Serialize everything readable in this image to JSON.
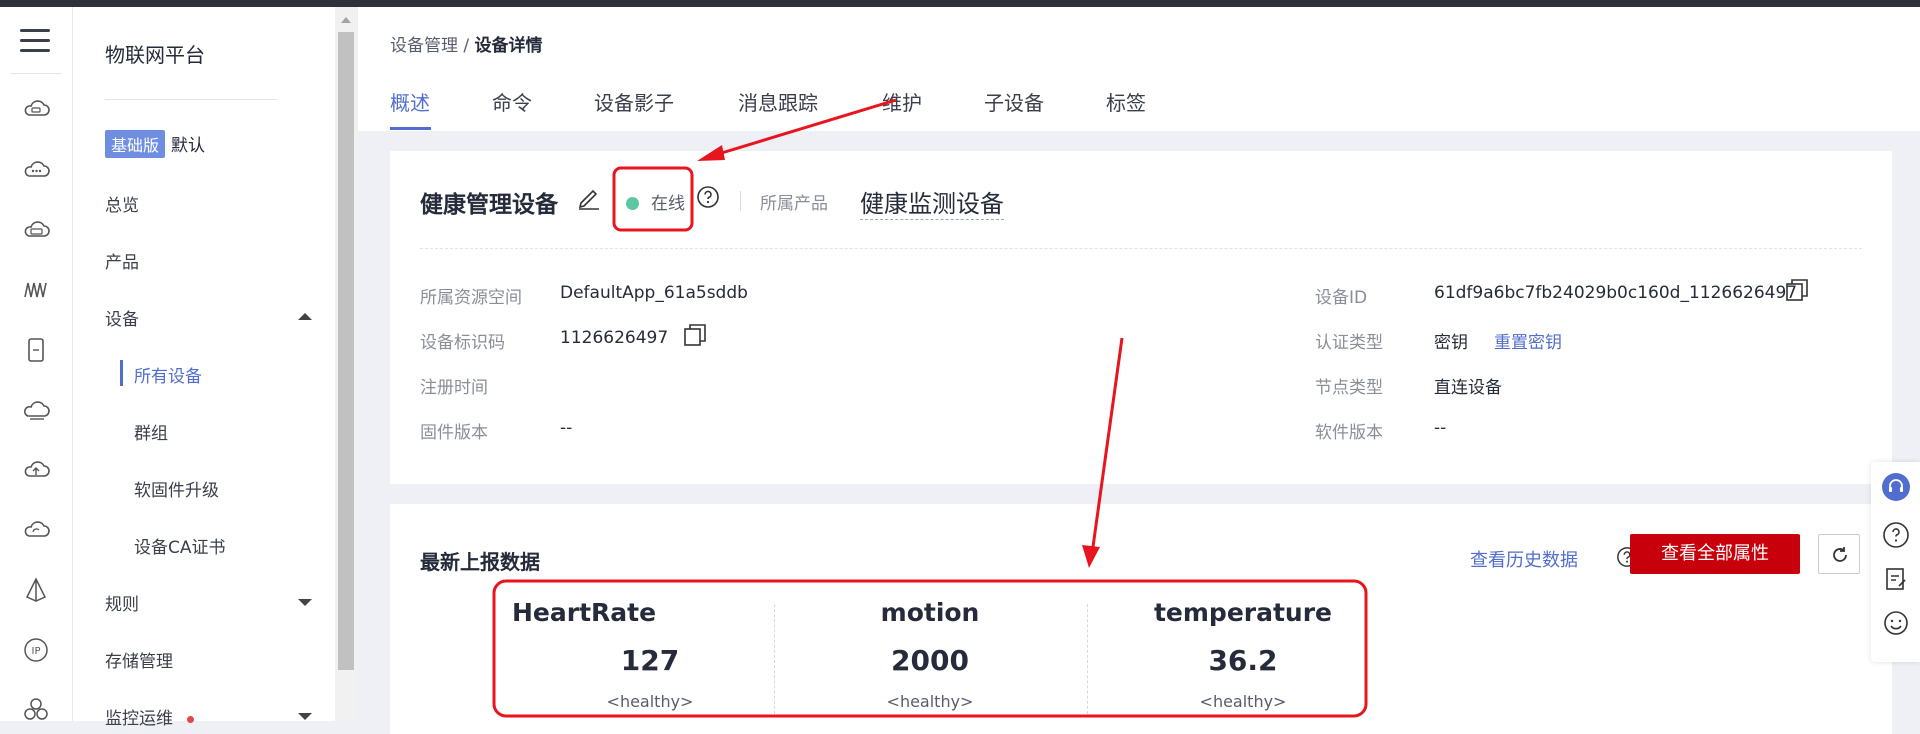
{
  "nav": {
    "title": "物联网平台",
    "edition_badge": "基础版",
    "edition_name": "默认",
    "items": [
      {
        "label": "总览"
      },
      {
        "label": "产品"
      },
      {
        "label": "设备"
      },
      {
        "label": "所有设备"
      },
      {
        "label": "群组"
      },
      {
        "label": "软固件升级"
      },
      {
        "label": "设备CA证书"
      },
      {
        "label": "规则"
      },
      {
        "label": "存储管理"
      },
      {
        "label": "监控运维"
      }
    ]
  },
  "breadcrumb": {
    "parent": "设备管理 / ",
    "current": "设备详情"
  },
  "tabs": [
    "概述",
    "命令",
    "设备影子",
    "消息跟踪",
    "维护",
    "子设备",
    "标签"
  ],
  "device": {
    "name": "健康管理设备",
    "status": "在线",
    "product_label": "所属产品",
    "product_name": "健康监测设备"
  },
  "details": {
    "left": [
      {
        "label": "所属资源空间",
        "value": "DefaultApp_61a5sddb"
      },
      {
        "label": "设备标识码",
        "value": "1126626497"
      },
      {
        "label": "注册时间",
        "value": ""
      },
      {
        "label": "固件版本",
        "value": "--"
      }
    ],
    "right": [
      {
        "label": "设备ID",
        "value": "61df9a6bc7fb24029b0c160d_1126626497"
      },
      {
        "label": "认证类型",
        "value": "密钥",
        "link": "重置密钥"
      },
      {
        "label": "节点类型",
        "value": "直连设备"
      },
      {
        "label": "软件版本",
        "value": "--"
      }
    ]
  },
  "latest": {
    "heading": "最新上报数据",
    "history_link": "查看历史数据",
    "view_all_button": "查看全部属性",
    "metrics": [
      {
        "name": "HeartRate",
        "value": "127",
        "status": "<healthy>"
      },
      {
        "name": "motion",
        "value": "2000",
        "status": "<healthy>"
      },
      {
        "name": "temperature",
        "value": "36.2",
        "status": "<healthy>"
      }
    ]
  },
  "colors": {
    "accent": "#526ecc",
    "primary_button": "#c7000b",
    "online": "#5cc8a2",
    "annotation": "#e8141e"
  }
}
